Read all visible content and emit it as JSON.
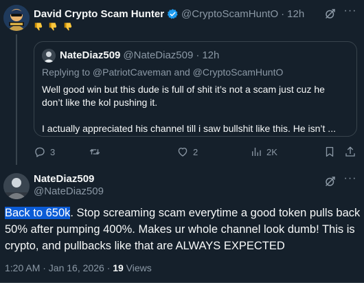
{
  "tweet": {
    "author_name": "David Crypto Scam Hunter",
    "author_handle": "@CryptoScamHuntO",
    "time": "12h",
    "dot": "·",
    "more": "···",
    "verified": true,
    "emoji_icons": [
      "thumbs-down-icon",
      "thumbs-down-icon",
      "thumbs-down-icon"
    ]
  },
  "quoted": {
    "author_name": "NateDiaz509",
    "author_handle": "@NateDiaz509",
    "time": "12h",
    "dot": "·",
    "replying_to": "Replying to @PatriotCaveman and @CryptoScamHuntO",
    "line1": "Well good win but this dude is full of shit it’s not a scam just cuz he",
    "line2": "don’t like the kol pushing it.",
    "line3": "I actually appreciated his channel till i saw bullshit like this. He isn’t ..."
  },
  "actions": {
    "replies": "3",
    "reposts": "",
    "likes": "2",
    "views": "2K"
  },
  "reply": {
    "author_name": "NateDiaz509",
    "author_handle": "@NateDiaz509",
    "more": "···",
    "highlight": "Back to 650k",
    "body": ". Stop screaming scam everytime a good token pulls back 50% after pumping 400%. Makes ur whole channel look dumb! This is crypto, and pullbacks like that are ALWAYS EXPECTED",
    "timestamp": "1:20 AM · Jan 16, 2026 · ",
    "views_count": "19",
    "views_label": " Views"
  },
  "colors": {
    "background": "#15202b",
    "text": "#f7f9f9",
    "secondary": "#8b98a5",
    "border": "#38444d",
    "verified": "#1d9bf0",
    "selection": "#0b5cd6"
  }
}
